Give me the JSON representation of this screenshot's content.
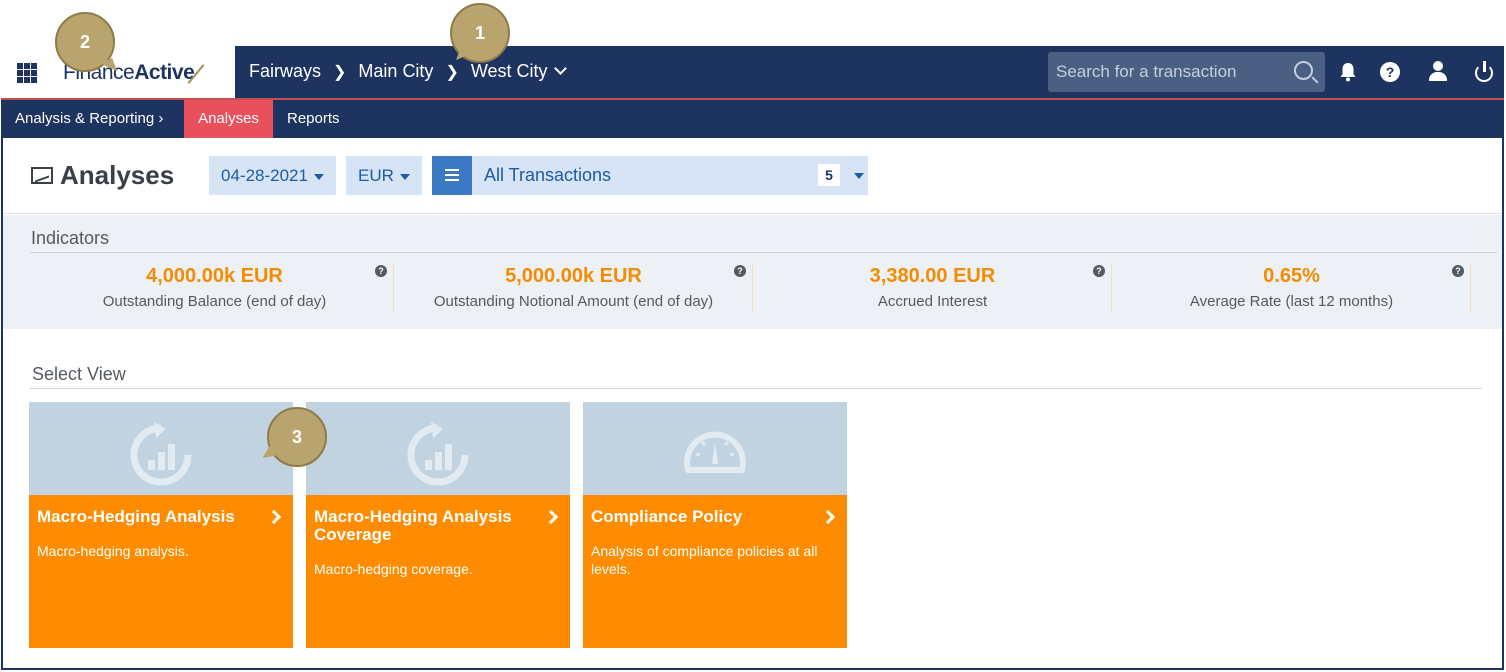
{
  "logo": {
    "text_light": "Finance",
    "text_bold": "Active"
  },
  "breadcrumb": {
    "items": [
      "Fairways",
      "Main City",
      "West City"
    ]
  },
  "search": {
    "placeholder": "Search for a transaction"
  },
  "subnav": {
    "section": "Analysis & Reporting ›",
    "tabs": [
      "Analyses",
      "Reports"
    ],
    "active": "Analyses"
  },
  "page": {
    "title": "Analyses",
    "date": "04-28-2021",
    "currency": "EUR",
    "transactions_label": "All Transactions",
    "transactions_count": "5"
  },
  "indicators": {
    "title": "Indicators",
    "items": [
      {
        "value": "4,000.00k EUR",
        "label": "Outstanding Balance (end of day)"
      },
      {
        "value": "5,000.00k EUR",
        "label": "Outstanding Notional Amount (end of day)"
      },
      {
        "value": "3,380.00 EUR",
        "label": "Accrued Interest"
      },
      {
        "value": "0.65%",
        "label": "Average Rate (last 12 months)"
      }
    ]
  },
  "select_view": {
    "title": "Select View",
    "cards": [
      {
        "title": "Macro-Hedging Analysis",
        "desc": "Macro-hedging analysis.",
        "icon": "refresh-chart-icon"
      },
      {
        "title": "Macro-Hedging Analysis Coverage",
        "desc": "Macro-hedging coverage.",
        "icon": "refresh-chart-icon"
      },
      {
        "title": "Compliance Policy",
        "desc": "Analysis of compliance policies at all levels.",
        "icon": "gauge-icon"
      }
    ]
  },
  "callouts": [
    "1",
    "2",
    "3"
  ],
  "colors": {
    "navy": "#1d3461",
    "accent_red": "#e8505b",
    "orange": "#ff8c00",
    "value_orange": "#f28c00",
    "light_blue": "#d6e4f5",
    "card_top": "#c1d2e0"
  }
}
